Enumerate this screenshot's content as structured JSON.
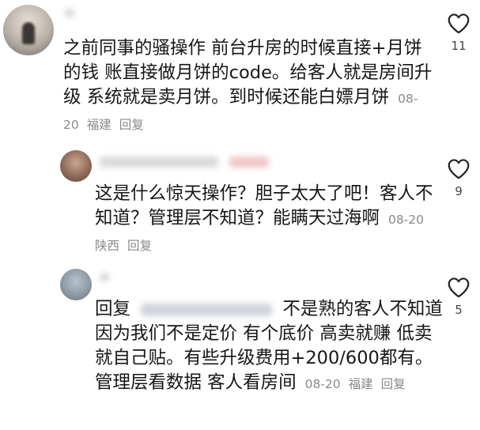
{
  "comments": [
    {
      "text": "之前同事的骚操作 前台升房的时候直接+月饼的钱 账直接做月饼的code。给客人就是房间升级 系统就是卖月饼。到时候还能白嫖月饼",
      "date": "08-20",
      "location": "福建",
      "reply_label": "回复",
      "likes": "11"
    },
    {
      "text": "这是什么惊天操作？胆子太大了吧！客人不知道？管理层不知道？能瞒天过海啊",
      "date": "08-20",
      "location": "陕西",
      "reply_label": "回复",
      "likes": "9"
    },
    {
      "reply_prefix": "回复",
      "text": "不是熟的客人不知道 因为我们不是定价 有个底价 高卖就赚 低卖就自己贴。有些升级费用+200/600都有。管理层看数据 客人看房间",
      "date": "08-20",
      "location": "福建",
      "reply_label": "回复",
      "likes": "5"
    }
  ],
  "icons": {
    "like": "heart-outline-icon"
  },
  "colors": {
    "text": "#161616",
    "meta": "#8a8a8a",
    "icon": "#222222"
  }
}
